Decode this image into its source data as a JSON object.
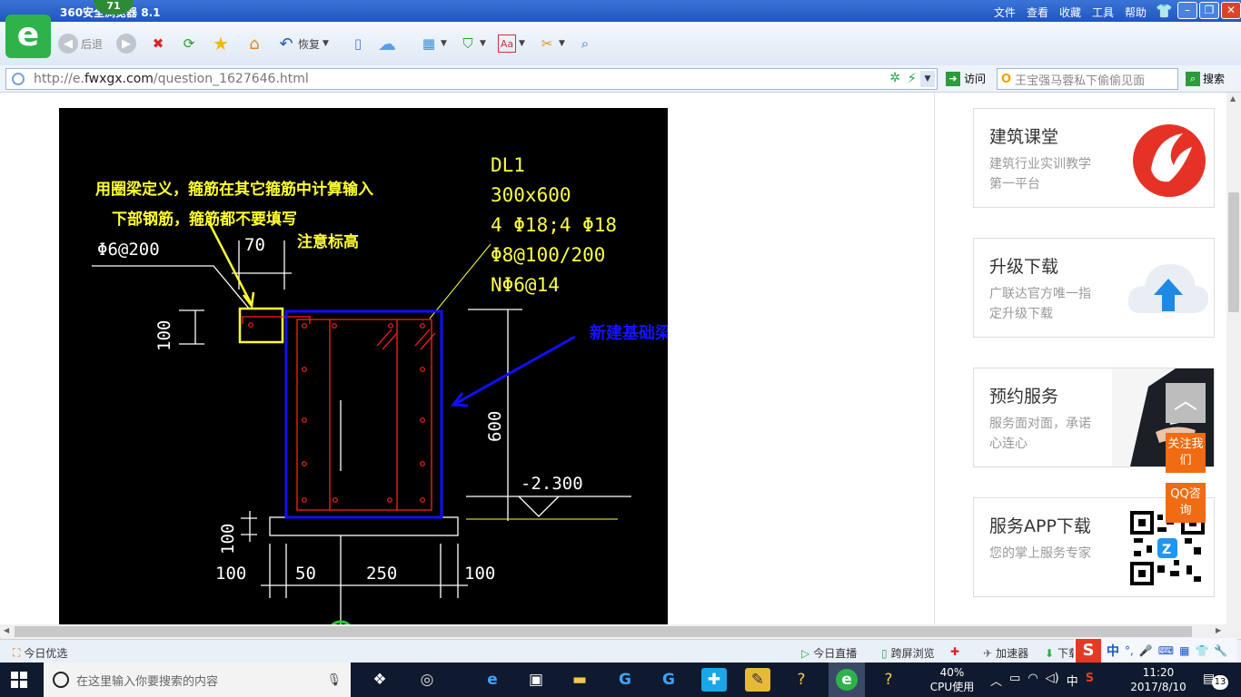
{
  "browser": {
    "title": "360安全浏览器 8.1",
    "badge": "71",
    "menu": [
      "文件",
      "查看",
      "收藏",
      "工具",
      "帮助"
    ],
    "toolbar": {
      "back": "后退",
      "restore": "恢复"
    },
    "url_prefix": "http://e.",
    "url_domain": "fwxgx.com",
    "url_path": "/question_1627646.html",
    "visit": "访问",
    "search_text": "王宝强马蓉私下偷偷见面",
    "search_button": "搜索"
  },
  "drawing": {
    "note_line1": "用圈梁定义，箍筋在其它箍筋中计算输入",
    "note_line2": "下部钢筋，箍筋都不要填写",
    "note_line3": "注意标高",
    "beam_name": "DL1",
    "beam_size": "300x600",
    "rebar_main": "4 Φ18;4 Φ18",
    "rebar_stirrup": "Φ8@100/200",
    "rebar_waist": "NΦ6@14",
    "spec_left": "Φ6@200",
    "dim_70": "70",
    "dim_100_top": "100",
    "dim_600": "600",
    "elevation": "-2.300",
    "dim_100_bottom": "100",
    "dim_100_left": "100",
    "dim_50": "50",
    "dim_250": "250",
    "dim_100_right": "100",
    "new_beam_label": "新建基础梁",
    "colors": {
      "yellow": "#ffff33",
      "red": "#ff2020",
      "blue": "#1010ff",
      "white": "#ffffff"
    }
  },
  "sidebar": [
    {
      "title": "建筑课堂",
      "desc": "建筑行业实训教学第一平台",
      "icon": "flame-logo-icon"
    },
    {
      "title": "升级下载",
      "desc": "广联达官方唯一指定升级下载",
      "icon": "cloud-upload-icon"
    },
    {
      "title": "预约服务",
      "desc": "服务面对面，承诺心连心",
      "icon": "handshake-photo"
    },
    {
      "title": "服务APP下载",
      "desc": "您的掌上服务专家",
      "icon": "qr-code-icon"
    }
  ],
  "float_buttons": {
    "follow": "关注我们",
    "qq": "QQ咨询"
  },
  "statusbar": {
    "left": "今日优选",
    "live": "今日直播",
    "cross": "跨屏浏览",
    "accelerator": "加速器",
    "download": "下载"
  },
  "taskbar": {
    "search_placeholder": "在这里输入你要搜索的内容",
    "cpu_percent": "40%",
    "cpu_label": "CPU使用",
    "ime": "中",
    "time": "11:20",
    "date": "2017/8/10",
    "notifications": "13"
  }
}
